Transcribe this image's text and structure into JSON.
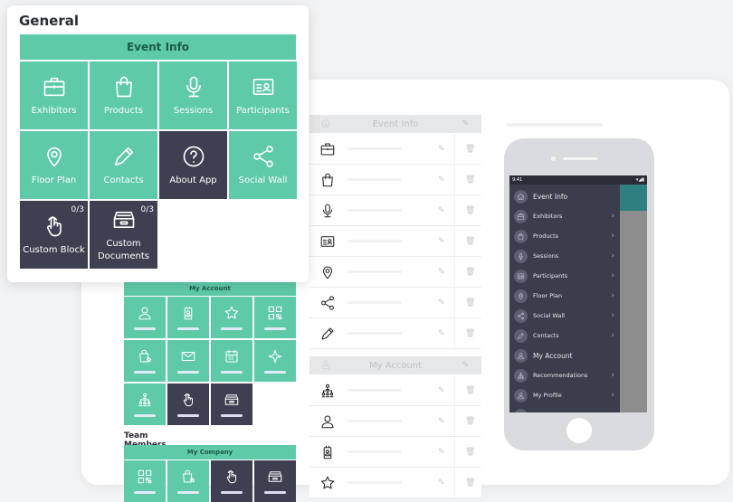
{
  "general": {
    "title": "General",
    "header": "Event Info",
    "tiles": [
      {
        "label": "Exhibitors",
        "icon": "briefcase",
        "dark": false
      },
      {
        "label": "Products",
        "icon": "bag",
        "dark": false
      },
      {
        "label": "Sessions",
        "icon": "mic",
        "dark": false
      },
      {
        "label": "Participants",
        "icon": "idcard",
        "dark": false
      },
      {
        "label": "Floor Plan",
        "icon": "pin",
        "dark": false
      },
      {
        "label": "Contacts",
        "icon": "pencil",
        "dark": false
      },
      {
        "label": "About App",
        "icon": "question",
        "dark": true
      },
      {
        "label": "Social Wall",
        "icon": "share",
        "dark": false
      },
      {
        "label": "Custom Block",
        "icon": "hand",
        "dark": true,
        "count": "0/3"
      },
      {
        "label": "Custom Documents",
        "icon": "archive",
        "dark": true,
        "count": "0/3"
      }
    ]
  },
  "my_account_grid": {
    "header": "My Account",
    "tiles": [
      {
        "icon": "user",
        "dark": false
      },
      {
        "icon": "badge",
        "dark": false
      },
      {
        "icon": "star",
        "dark": false
      },
      {
        "icon": "qr",
        "dark": false
      },
      {
        "icon": "bagstar",
        "dark": false
      },
      {
        "icon": "envelope",
        "dark": false
      },
      {
        "icon": "calendar",
        "dark": false
      },
      {
        "icon": "sparkle",
        "dark": false
      },
      {
        "icon": "org",
        "dark": false
      },
      {
        "icon": "hand",
        "dark": true
      },
      {
        "icon": "archive",
        "dark": true
      }
    ]
  },
  "team_members": {
    "title": "Team Members",
    "header": "My Company",
    "tiles": [
      {
        "icon": "qr",
        "dark": false
      },
      {
        "icon": "bagstar",
        "dark": false
      },
      {
        "icon": "hand",
        "dark": true
      },
      {
        "icon": "archive",
        "dark": true
      }
    ]
  },
  "module_list": {
    "sections": [
      {
        "header": "Event Info",
        "icon": "home",
        "rows": [
          "briefcase",
          "bag",
          "mic",
          "idcard",
          "pin",
          "share",
          "pencil"
        ]
      },
      {
        "header": "My Account",
        "icon": "user",
        "rows": [
          "org",
          "user",
          "badge",
          "star"
        ]
      }
    ]
  },
  "phone": {
    "time": "9:41",
    "menu": [
      {
        "label": "Event Info",
        "icon": "home",
        "header": true
      },
      {
        "label": "Exhibitors",
        "icon": "briefcase"
      },
      {
        "label": "Products",
        "icon": "bag"
      },
      {
        "label": "Sessions",
        "icon": "mic"
      },
      {
        "label": "Participants",
        "icon": "idcard"
      },
      {
        "label": "Floor Plan",
        "icon": "pin"
      },
      {
        "label": "Social Wall",
        "icon": "share"
      },
      {
        "label": "Contacts",
        "icon": "pencil"
      },
      {
        "label": "My Account",
        "icon": "user",
        "header": true
      },
      {
        "label": "Recommendations",
        "icon": "org"
      },
      {
        "label": "My Profile",
        "icon": "user"
      },
      {
        "label": "My Badge",
        "icon": "badge"
      }
    ]
  },
  "colors": {
    "teal": "#5ecaa8",
    "dark": "#3e4051",
    "drawer": "#3a3d4b"
  }
}
